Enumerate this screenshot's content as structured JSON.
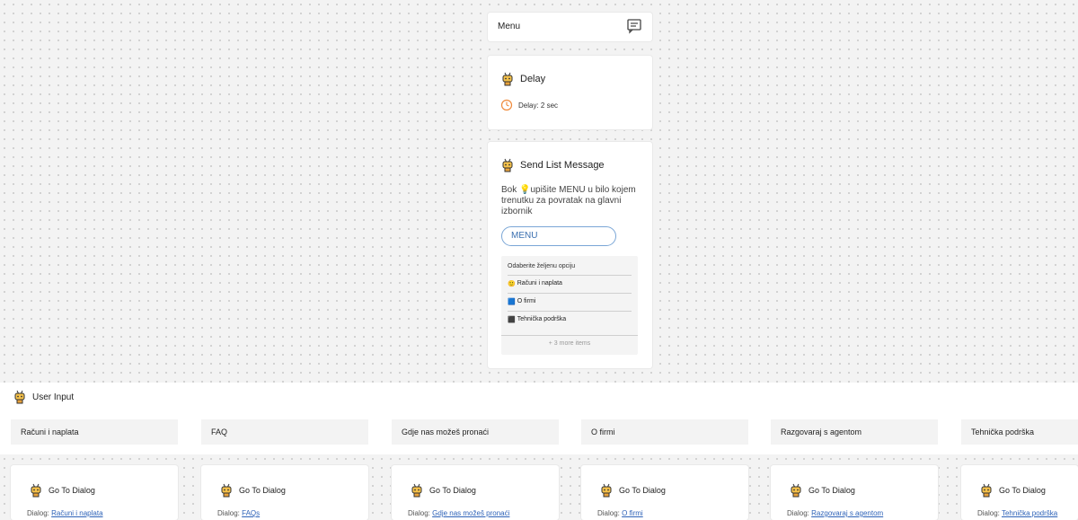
{
  "menu_node": {
    "label": "Menu",
    "icon": "message-square-icon"
  },
  "delay_node": {
    "title": "Delay",
    "detail": "Delay: 2 sec",
    "icon": "clock-icon"
  },
  "list_node": {
    "title": "Send List Message",
    "message": "Bok 💡upišite MENU u bilo kojem trenutku za povratak na glavni izbornik",
    "button_label": "MENU",
    "list_header": "Odaberite željenu opciju",
    "items": [
      {
        "emoji": "🙂",
        "label": "Računi i naplata"
      },
      {
        "emoji": "🟦",
        "label": "O firmi"
      },
      {
        "emoji": "⬛",
        "label": "Tehnička podrška"
      }
    ],
    "more": "+ 3 more items"
  },
  "user_input": {
    "label": "User Input"
  },
  "options": [
    "Računi i naplata",
    "FAQ",
    "Gdje nas možeš pronaći",
    "O firmi",
    "Razgovaraj s agentom",
    "Tehnička podrška"
  ],
  "goto_nodes": [
    {
      "title": "Go To Dialog",
      "prefix": "Dialog:",
      "target": "Računi i naplata"
    },
    {
      "title": "Go To Dialog",
      "prefix": "Dialog:",
      "target": "FAQs"
    },
    {
      "title": "Go To Dialog",
      "prefix": "Dialog:",
      "target": "Gdje nas možeš pronaći"
    },
    {
      "title": "Go To Dialog",
      "prefix": "Dialog:",
      "target": "O firmi"
    },
    {
      "title": "Go To Dialog",
      "prefix": "Dialog:",
      "target": "Razgovaraj s agentom"
    },
    {
      "title": "Go To Dialog",
      "prefix": "Dialog:",
      "target": "Tehnička podrška"
    }
  ],
  "colors": {
    "link": "#2f63b8",
    "pill_border": "#7aa6d6",
    "canvas": "#f3f3f3"
  }
}
